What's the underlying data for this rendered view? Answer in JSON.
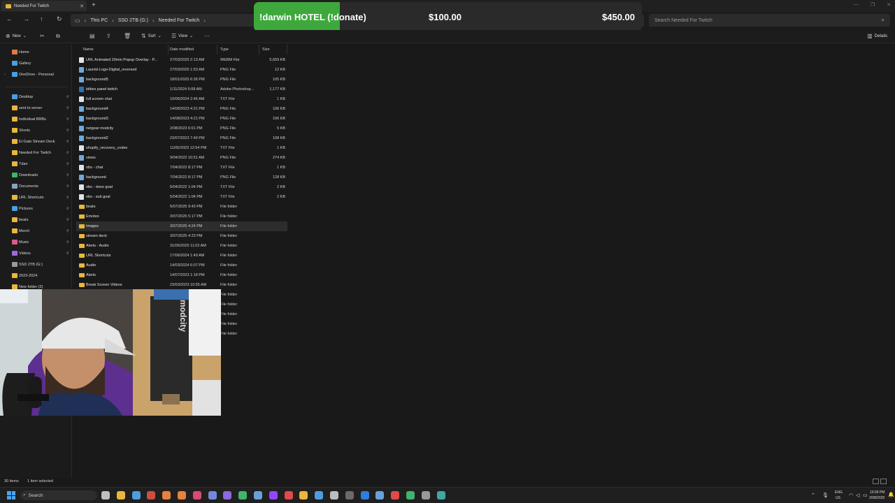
{
  "window": {
    "tab_title": "Needed For Twitch",
    "new_tab_symbol": "+",
    "controls": [
      "—",
      "❐",
      "✕"
    ]
  },
  "breadcrumb": [
    "This PC",
    "SSD 2TB (G:)",
    "Needed For Twitch"
  ],
  "search": {
    "placeholder": "Search Needed For Twitch"
  },
  "overlay": {
    "title": "!darwin HOTEL (!donate)",
    "current": "$100.00",
    "goal": "$450.00",
    "progress_fraction": 0.222,
    "fill_color": "#3fa83d"
  },
  "toolbar": {
    "new_label": "New",
    "sort_label": "Sort",
    "view_label": "View",
    "more_symbol": "···",
    "details_label": "Details"
  },
  "sidebar": {
    "top_items": [
      {
        "label": "Home",
        "icon": "home-icon",
        "color": "#e07a4a"
      },
      {
        "label": "Gallery",
        "icon": "gallery-icon",
        "color": "#4a9fe0"
      },
      {
        "label": "OneDrive - Personal",
        "icon": "cloud-icon",
        "color": "#4a9fe0"
      }
    ],
    "pinned_items": [
      {
        "label": "Desktop",
        "color": "#4a9fe0"
      },
      {
        "label": "sent to server",
        "color": "#e8b73d"
      },
      {
        "label": "Individual BRBs",
        "color": "#e8b73d"
      },
      {
        "label": "Shorts",
        "color": "#e8b73d"
      },
      {
        "label": "El Gato Stream Deck",
        "color": "#e8b73d"
      },
      {
        "label": "Needed For Twitch",
        "color": "#e8b73d"
      },
      {
        "label": "Tdan",
        "color": "#e8b73d"
      },
      {
        "label": "Downloads",
        "color": "#3fb46a"
      },
      {
        "label": "Documents",
        "color": "#8aa2c0"
      },
      {
        "label": "URL Shortcuts",
        "color": "#e8b73d"
      },
      {
        "label": "Pictures",
        "color": "#4a9fe0"
      },
      {
        "label": "beats",
        "color": "#e8b73d"
      },
      {
        "label": "Merch",
        "color": "#e8b73d"
      },
      {
        "label": "Music",
        "color": "#d95b8c"
      },
      {
        "label": "Videos",
        "color": "#9a6ad9"
      },
      {
        "label": "SSD 2TB (G:)",
        "color": "#9a9a9a"
      },
      {
        "label": "2023-2024",
        "color": "#e8b73d"
      },
      {
        "label": "New folder (2)",
        "color": "#e8b73d"
      }
    ]
  },
  "columns": {
    "name": "Name",
    "date": "Date modified",
    "type": "Type",
    "size": "Size"
  },
  "files": [
    {
      "name": "URL Animated 20min Popup Overlay - P...",
      "date": "27/03/2025 2:13 AM",
      "type": "WEBM File",
      "size": "5,659 KB",
      "kind": "file"
    },
    {
      "name": "Launtd-Logo-Digital_reversed",
      "date": "27/03/2025 1:53 AM",
      "type": "PNG File",
      "size": "12 KB",
      "kind": "img"
    },
    {
      "name": "background5",
      "date": "18/01/2025 6:36 PM",
      "type": "PNG File",
      "size": "105 KB",
      "kind": "img"
    },
    {
      "name": "bitties panel twitch",
      "date": "1/11/2024 6:08 AM",
      "type": "Adobe Photoshop...",
      "size": "1,177 KB",
      "kind": "psd"
    },
    {
      "name": "full screen chat",
      "date": "10/06/2024 2:46 AM",
      "type": "TXT File",
      "size": "1 KB",
      "kind": "file"
    },
    {
      "name": "background4",
      "date": "14/08/2023 4:21 PM",
      "type": "PNG File",
      "size": "106 KB",
      "kind": "img"
    },
    {
      "name": "background3",
      "date": "14/08/2023 4:21 PM",
      "type": "PNG File",
      "size": "106 KB",
      "kind": "img"
    },
    {
      "name": "netgear modcity",
      "date": "2/08/2023 6:01 PM",
      "type": "PNG File",
      "size": "5 KB",
      "kind": "img"
    },
    {
      "name": "background2",
      "date": "23/07/2023 7:49 PM",
      "type": "PNG File",
      "size": "108 KB",
      "kind": "img"
    },
    {
      "name": "shopify_recovery_codes",
      "date": "11/05/2023 12:54 PM",
      "type": "TXT File",
      "size": "1 KB",
      "kind": "file"
    },
    {
      "name": "views",
      "date": "9/04/2022 10:51 AM",
      "type": "PNG File",
      "size": "274 KB",
      "kind": "img"
    },
    {
      "name": "obs - chat",
      "date": "7/04/2022 8:17 PM",
      "type": "TXT File",
      "size": "1 KB",
      "kind": "file"
    },
    {
      "name": "background",
      "date": "7/04/2022 8:17 PM",
      "type": "PNG File",
      "size": "128 KB",
      "kind": "img"
    },
    {
      "name": "obs - dono goal",
      "date": "5/04/2022 1:04 PM",
      "type": "TXT File",
      "size": "2 KB",
      "kind": "file"
    },
    {
      "name": "obs - sub goal",
      "date": "5/04/2022 1:04 PM",
      "type": "TXT File",
      "size": "2 KB",
      "kind": "file"
    },
    {
      "name": "beats",
      "date": "5/07/2025 9:43 PM",
      "type": "File folder",
      "size": "",
      "kind": "folder"
    },
    {
      "name": "Emotes",
      "date": "3/07/2025 5:17 PM",
      "type": "File folder",
      "size": "",
      "kind": "folder"
    },
    {
      "name": "Images",
      "date": "3/07/2025 4:24 PM",
      "type": "File folder",
      "size": "",
      "kind": "folder",
      "selected": true
    },
    {
      "name": "stream deck",
      "date": "3/07/2025 4:23 PM",
      "type": "File folder",
      "size": "",
      "kind": "folder"
    },
    {
      "name": "Alerts - Audio",
      "date": "31/05/2025 11:02 AM",
      "type": "File folder",
      "size": "",
      "kind": "folder"
    },
    {
      "name": "URL Shortcuts",
      "date": "17/06/2024 1:49 AM",
      "type": "File folder",
      "size": "",
      "kind": "folder"
    },
    {
      "name": "Audio",
      "date": "14/03/2024 6:07 PM",
      "type": "File folder",
      "size": "",
      "kind": "folder"
    },
    {
      "name": "Alerts",
      "date": "14/07/2023 1:18 PM",
      "type": "File folder",
      "size": "",
      "kind": "folder"
    },
    {
      "name": "Break Screen Videos",
      "date": "23/03/2023 10:55 AM",
      "type": "File folder",
      "size": "",
      "kind": "folder"
    },
    {
      "name": "",
      "date": "",
      "type": "File folder",
      "size": "",
      "kind": "hidden"
    },
    {
      "name": "",
      "date": "",
      "type": "File folder",
      "size": "",
      "kind": "hidden"
    },
    {
      "name": "",
      "date": "",
      "type": "File folder",
      "size": "",
      "kind": "hidden"
    },
    {
      "name": "",
      "date": "",
      "type": "File folder",
      "size": "",
      "kind": "hidden"
    },
    {
      "name": "",
      "date": "",
      "type": "File folder",
      "size": "",
      "kind": "hidden"
    }
  ],
  "webcam": {
    "shirt_text": "modcity"
  },
  "status": {
    "items_count": "30 items",
    "selected": "1 item selected"
  },
  "taskbar": {
    "search_label": "Search",
    "apps": [
      {
        "icon": "task-view-icon",
        "color": "#bfbfbf"
      },
      {
        "icon": "file-explorer-icon",
        "color": "#e8b73d"
      },
      {
        "icon": "chrome-icon",
        "color": "#4a9fe0"
      },
      {
        "icon": "app-icon-4",
        "color": "#c94f3f"
      },
      {
        "icon": "app-icon-5",
        "color": "#e8813d"
      },
      {
        "icon": "firefox-icon",
        "color": "#e8813d"
      },
      {
        "icon": "app-icon-7",
        "color": "#d94a72"
      },
      {
        "icon": "discord-icon",
        "color": "#7289da"
      },
      {
        "icon": "app-icon-9",
        "color": "#8b6ad9"
      },
      {
        "icon": "app-icon-10",
        "color": "#3fb46a"
      },
      {
        "icon": "steam-icon",
        "color": "#6aa0d9"
      },
      {
        "icon": "twitch-icon",
        "color": "#9146ff"
      },
      {
        "icon": "app-icon-13",
        "color": "#e04a4a"
      },
      {
        "icon": "app-icon-14",
        "color": "#e8b73d"
      },
      {
        "icon": "app-icon-15",
        "color": "#4a9fe0"
      },
      {
        "icon": "app-icon-16",
        "color": "#bdbdbd"
      },
      {
        "icon": "app-icon-17",
        "color": "#6a6a6a"
      },
      {
        "icon": "app-icon-18",
        "color": "#2d7fd9"
      },
      {
        "icon": "app-icon-19",
        "color": "#6aa0d9"
      },
      {
        "icon": "app-icon-20",
        "color": "#e04a4a"
      },
      {
        "icon": "app-icon-21",
        "color": "#3fb46a"
      },
      {
        "icon": "settings-icon",
        "color": "#9a9a9a"
      },
      {
        "icon": "app-icon-23",
        "color": "#3fa8a0"
      }
    ],
    "tray": {
      "lang": "ENG",
      "region": "US",
      "time": "10:06 PM",
      "date": "2/08/2025"
    }
  }
}
